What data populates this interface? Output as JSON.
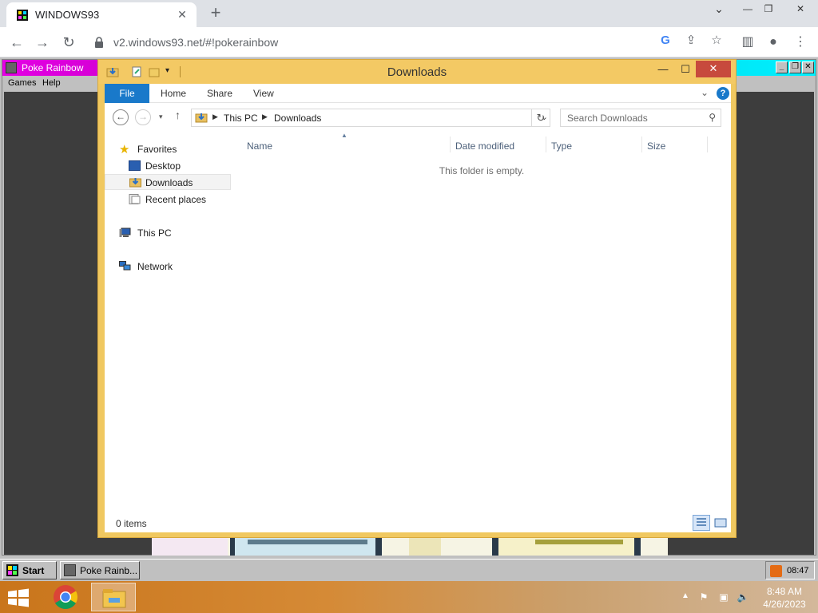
{
  "browser": {
    "tab_title": "WINDOWS93",
    "url": "v2.windows93.net/#!pokerainbow",
    "window_controls": {
      "minimize": "—",
      "restore": "❐",
      "close": "✕"
    }
  },
  "poke_window": {
    "title": "Poke Rainbow",
    "menu": [
      "Games",
      "Help"
    ]
  },
  "explorer": {
    "title": "Downloads",
    "ribbon_tabs": [
      "File",
      "Home",
      "Share",
      "View"
    ],
    "breadcrumb": [
      "This PC",
      "Downloads"
    ],
    "search_placeholder": "Search Downloads",
    "nav": {
      "favorites": "Favorites",
      "desktop": "Desktop",
      "downloads": "Downloads",
      "recent": "Recent places",
      "this_pc": "This PC",
      "network": "Network"
    },
    "columns": [
      "Name",
      "Date modified",
      "Type",
      "Size"
    ],
    "empty_message": "This folder is empty.",
    "status": "0 items"
  },
  "w93_taskbar": {
    "start_label": "Start",
    "task_label": "Poke Rainb...",
    "clock": "08:47"
  },
  "win8_taskbar": {
    "time": "8:48 AM",
    "date": "4/26/2023"
  },
  "colors": {
    "explorer_frame": "#f3c964",
    "file_tab": "#1979ca",
    "close_button": "#c74a3d",
    "poke_title_start": "#e400e4",
    "poke_title_end": "#00f0ff"
  }
}
